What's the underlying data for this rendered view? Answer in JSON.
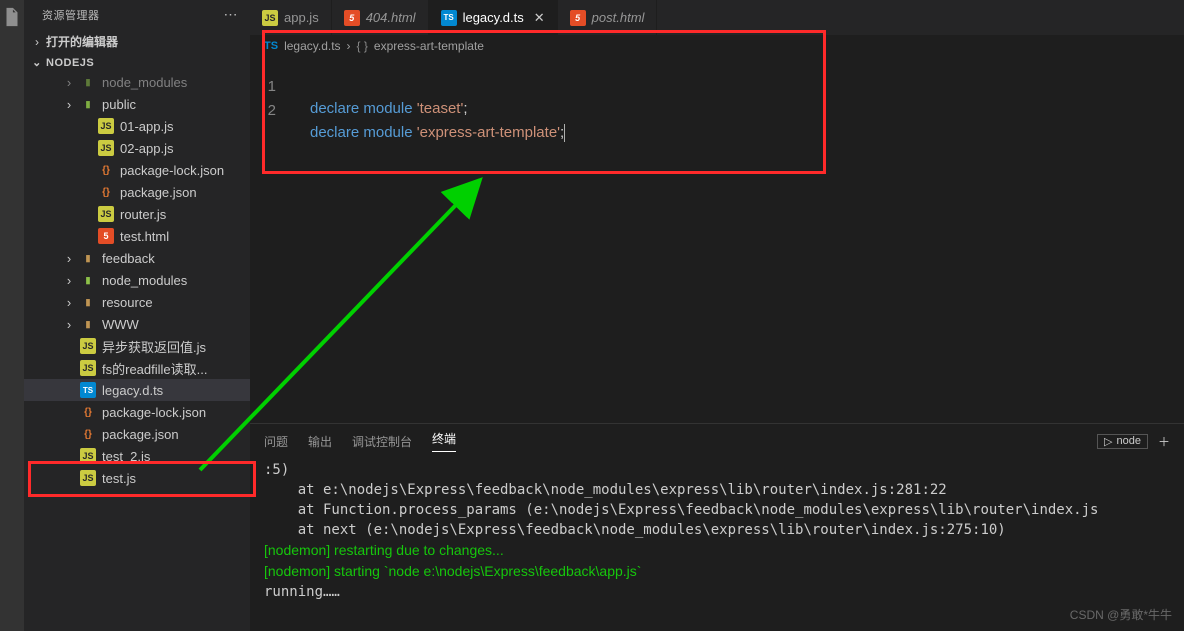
{
  "sidebar": {
    "title": "资源管理器",
    "opened_editors": "打开的编辑器",
    "project": "NODEJS",
    "items": [
      {
        "icon": "nm",
        "label": "node_modules",
        "chev": "›",
        "d": 1,
        "dim": true
      },
      {
        "icon": "fold-g",
        "label": "public",
        "chev": "›",
        "d": 1
      },
      {
        "icon": "js",
        "label": "01-app.js",
        "d": 2
      },
      {
        "icon": "js",
        "label": "02-app.js",
        "d": 2
      },
      {
        "icon": "json",
        "label": "package-lock.json",
        "d": 2
      },
      {
        "icon": "json",
        "label": "package.json",
        "d": 2
      },
      {
        "icon": "js",
        "label": "router.js",
        "d": 2
      },
      {
        "icon": "html",
        "label": "test.html",
        "d": 2
      },
      {
        "icon": "fold",
        "label": "feedback",
        "chev": "›",
        "d": 1
      },
      {
        "icon": "nm",
        "label": "node_modules",
        "chev": "›",
        "d": 1
      },
      {
        "icon": "fold",
        "label": "resource",
        "chev": "›",
        "d": 1
      },
      {
        "icon": "fold",
        "label": "WWW",
        "chev": "›",
        "d": 1
      },
      {
        "icon": "js",
        "label": "异步获取返回值.js",
        "d": 1
      },
      {
        "icon": "js",
        "label": "fs的readfille读取...",
        "d": 1
      },
      {
        "icon": "ts",
        "label": "legacy.d.ts",
        "d": 1,
        "sel": true
      },
      {
        "icon": "json",
        "label": "package-lock.json",
        "d": 1
      },
      {
        "icon": "json",
        "label": "package.json",
        "d": 1
      },
      {
        "icon": "js",
        "label": "test_2.js",
        "d": 1
      },
      {
        "icon": "js",
        "label": "test.js",
        "d": 1
      }
    ]
  },
  "tabs": [
    {
      "icon": "js",
      "label": "app.js"
    },
    {
      "icon": "html",
      "label": "404.html",
      "italic": true
    },
    {
      "icon": "ts",
      "label": "legacy.d.ts",
      "active": true
    },
    {
      "icon": "html",
      "label": "post.html",
      "italic": true
    }
  ],
  "breadcrumb": {
    "ts": "TS",
    "file": "legacy.d.ts",
    "sep": "›",
    "sym": "{ }",
    "name": "express-art-template"
  },
  "code": {
    "l1": {
      "kw1": "declare",
      "kw2": "module",
      "str": "'teaset'",
      "end": ";"
    },
    "l2": {
      "kw1": "declare",
      "kw2": "module",
      "str": "'express-art-template'",
      "end": ";"
    }
  },
  "panel": {
    "tabs": {
      "problems": "问题",
      "output": "输出",
      "debug": "调试控制台",
      "terminal": "终端"
    },
    "node": "node",
    "lines": [
      ":5)",
      "    at e:\\nodejs\\Express\\feedback\\node_modules\\express\\lib\\router\\index.js:281:22",
      "    at Function.process_params (e:\\nodejs\\Express\\feedback\\node_modules\\express\\lib\\router\\index.js",
      "    at next (e:\\nodejs\\Express\\feedback\\node_modules\\express\\lib\\router\\index.js:275:10)"
    ],
    "nodemon1": "[nodemon] restarting due to changes...",
    "nodemon2": "[nodemon] starting `node e:\\nodejs\\Express\\feedback\\app.js`",
    "running": "running……"
  },
  "watermark": "CSDN @勇敢*牛牛"
}
